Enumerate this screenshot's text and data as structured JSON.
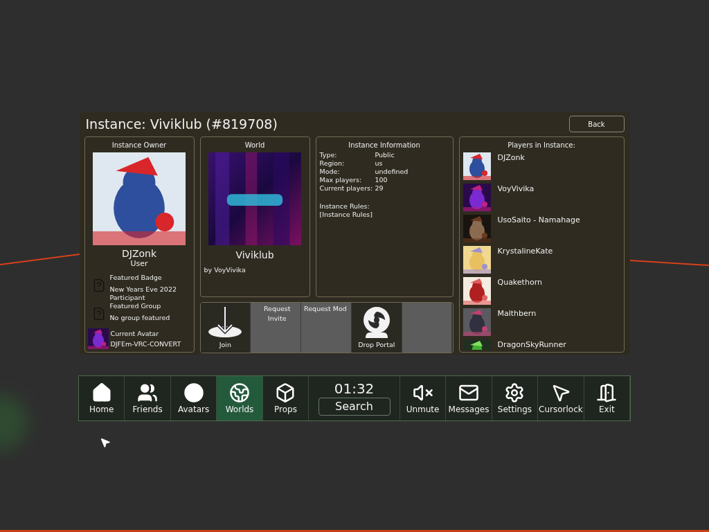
{
  "title": "Instance: Viviklub (#819708)",
  "back_button": "Back",
  "owner": {
    "heading": "Instance Owner",
    "name": "DJZonk",
    "role": "User",
    "details": [
      {
        "label": "Featured Badge",
        "value": "New Years Eve 2022 Participant"
      },
      {
        "label": "Featured Group",
        "value": "No group featured"
      }
    ],
    "avatar": {
      "label": "Current Avatar",
      "value": "DJFEm-VRC-CONVERT"
    }
  },
  "world": {
    "heading": "World",
    "name": "Viviklub",
    "author": "by VoyVivika"
  },
  "actions": [
    {
      "label": "Join",
      "disabled": false
    },
    {
      "label": "Request Invite",
      "disabled": true
    },
    {
      "label": "Request Mod",
      "disabled": true
    },
    {
      "label": "Drop Portal",
      "disabled": false
    },
    {
      "disabled": true
    }
  ],
  "info": {
    "heading": "Instance Information",
    "rows": [
      {
        "label": "Type:",
        "value": "Public"
      },
      {
        "label": "Region:",
        "value": "us"
      },
      {
        "label": "Mode:",
        "value": "undefined"
      },
      {
        "label": "Max players:",
        "value": "100"
      },
      {
        "label": "Current players:",
        "value": "29"
      }
    ],
    "rules_label": "Instance Rules:",
    "rules_value": "[Instance Rules]"
  },
  "players": {
    "heading": "Players in Instance:",
    "items": [
      {
        "name": "DJZonk"
      },
      {
        "name": "VoyVivika"
      },
      {
        "name": "UsoSaito - Namahage"
      },
      {
        "name": "KrystalineKate"
      },
      {
        "name": "Quakethorn"
      },
      {
        "name": "Malthbern"
      },
      {
        "name": "DragonSkyRunner"
      }
    ]
  },
  "nav": [
    {
      "kind": "button",
      "label": "Home",
      "selected": false
    },
    {
      "kind": "button",
      "label": "Friends",
      "selected": false
    },
    {
      "kind": "button",
      "label": "Avatars",
      "selected": false
    },
    {
      "kind": "button",
      "label": "Worlds",
      "selected": true
    },
    {
      "kind": "button",
      "label": "Props",
      "selected": false
    },
    {
      "kind": "clock",
      "time": "01:32",
      "label": "Search"
    },
    {
      "kind": "button",
      "label": "Unmute",
      "selected": false
    },
    {
      "kind": "button",
      "label": "Messages",
      "selected": false
    },
    {
      "kind": "button",
      "label": "Settings",
      "selected": false
    },
    {
      "kind": "button",
      "label": "Cursorlock",
      "selected": false
    },
    {
      "kind": "button",
      "label": "Exit",
      "selected": false
    }
  ]
}
